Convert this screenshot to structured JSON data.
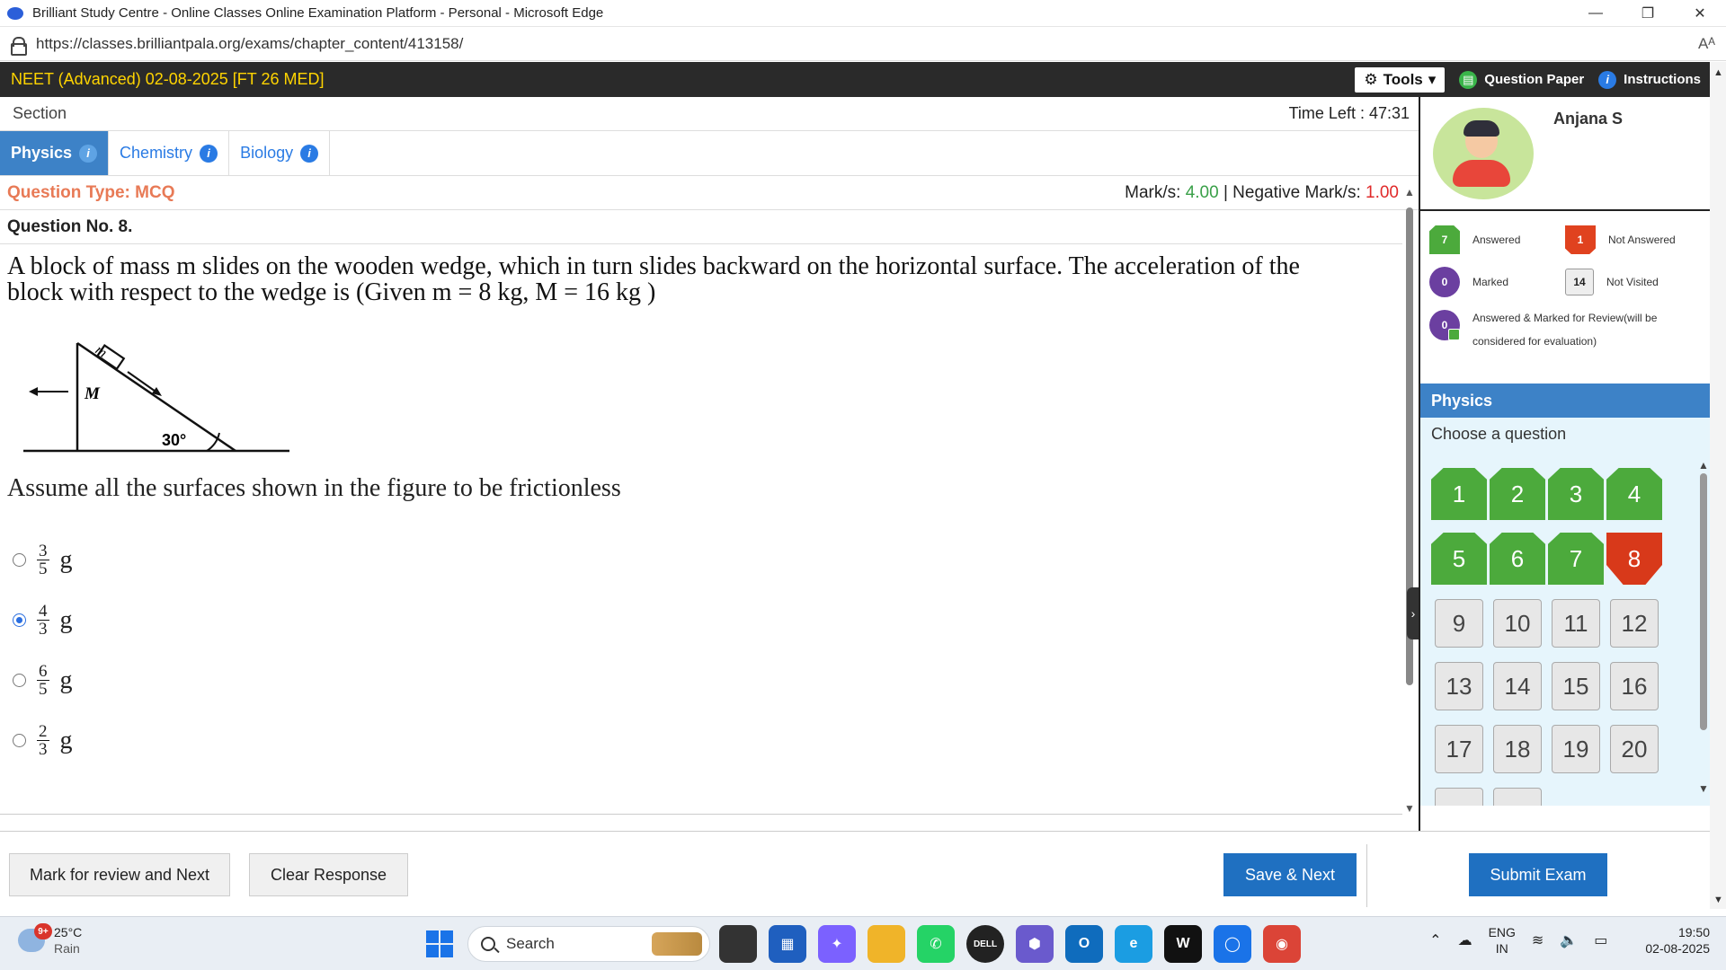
{
  "browser": {
    "window_title": "Brilliant Study Centre - Online Classes Online Examination Platform - Personal - Microsoft Edge",
    "url": "https://classes.brilliantpala.org/exams/chapter_content/413158/",
    "read_aloud_label": "Aᴬ",
    "minimize": "—",
    "restore": "❐",
    "close": "✕"
  },
  "exam": {
    "title": "NEET (Advanced) 02-08-2025 [FT 26 MED]",
    "tools_label": "Tools",
    "tools_icon": "⚙",
    "tools_caret": "▾",
    "question_paper_label": "Question Paper",
    "question_paper_icon": "▤",
    "instructions_label": "Instructions",
    "instructions_icon": "i"
  },
  "section": {
    "label": "Section",
    "time_left": "Time Left : 47:31",
    "tabs": [
      {
        "label": "Physics",
        "active": true
      },
      {
        "label": "Chemistry",
        "active": false
      },
      {
        "label": "Biology",
        "active": false
      }
    ],
    "info_icon": "i"
  },
  "question": {
    "type_label": "Question Type: MCQ",
    "marks_prefix": "Mark/s: ",
    "marks_value": "4.00",
    "neg_prefix": " | Negative Mark/s: ",
    "neg_value": "1.00",
    "number_label": "Question No. 8.",
    "text_line1": "A block of mass m slides on the wooden wedge, which in turn slides backward on the horizontal surface. The acceleration of the",
    "text_line2": "block with respect to the wedge is (Given m = 8 kg, M = 16 kg )",
    "figure": {
      "mass_label": "m",
      "wedge_label": "M",
      "angle_label": "30°"
    },
    "assume_text": "Assume all the surfaces shown in the figure to be frictionless",
    "options": [
      {
        "num": "3",
        "den": "5",
        "unit": "g",
        "selected": false
      },
      {
        "num": "4",
        "den": "3",
        "unit": "g",
        "selected": true
      },
      {
        "num": "6",
        "den": "5",
        "unit": "g",
        "selected": false
      },
      {
        "num": "2",
        "den": "3",
        "unit": "g",
        "selected": false
      }
    ]
  },
  "candidate": {
    "name": "Anjana S"
  },
  "legend": {
    "answered": {
      "count": "7",
      "label": "Answered"
    },
    "not_answered": {
      "count": "1",
      "label": "Not Answered"
    },
    "marked": {
      "count": "0",
      "label": "Marked"
    },
    "not_visited": {
      "count": "14",
      "label": "Not Visited"
    },
    "answered_marked": {
      "count": "0",
      "label": "Answered & Marked for Review(will be considered for evaluation)"
    }
  },
  "palette": {
    "section_title": "Physics",
    "choose_label": "Choose a question",
    "questions": [
      {
        "n": "1",
        "status": "ans"
      },
      {
        "n": "2",
        "status": "ans"
      },
      {
        "n": "3",
        "status": "ans"
      },
      {
        "n": "4",
        "status": "ans"
      },
      {
        "n": "5",
        "status": "ans"
      },
      {
        "n": "6",
        "status": "ans"
      },
      {
        "n": "7",
        "status": "ans"
      },
      {
        "n": "8",
        "status": "nans"
      },
      {
        "n": "9",
        "status": "nv"
      },
      {
        "n": "10",
        "status": "nv"
      },
      {
        "n": "11",
        "status": "nv"
      },
      {
        "n": "12",
        "status": "nv"
      },
      {
        "n": "13",
        "status": "nv"
      },
      {
        "n": "14",
        "status": "nv"
      },
      {
        "n": "15",
        "status": "nv"
      },
      {
        "n": "16",
        "status": "nv"
      },
      {
        "n": "17",
        "status": "nv"
      },
      {
        "n": "18",
        "status": "nv"
      },
      {
        "n": "19",
        "status": "nv"
      },
      {
        "n": "20",
        "status": "nv"
      },
      {
        "n": "",
        "status": "nv"
      },
      {
        "n": "",
        "status": "nv"
      }
    ]
  },
  "footer": {
    "mark_review_label": "Mark for review and Next",
    "clear_label": "Clear Response",
    "save_next_label": "Save & Next",
    "submit_label": "Submit Exam"
  },
  "taskbar": {
    "weather_badge": "9+",
    "temperature": "25°C",
    "weather": "Rain",
    "search_label": "Search",
    "lang1": "ENG",
    "lang2": "IN",
    "time": "19:50",
    "date": "02-08-2025",
    "apps": [
      {
        "name": "task-view-icon",
        "color": "#333333",
        "glyph": ""
      },
      {
        "name": "store-icon",
        "color": "#1f5fbf",
        "glyph": "▦"
      },
      {
        "name": "copilot-icon",
        "color": "#7b61ff",
        "glyph": "✦"
      },
      {
        "name": "file-explorer-icon",
        "color": "#f0b429",
        "glyph": ""
      },
      {
        "name": "whatsapp-icon",
        "color": "#25d366",
        "glyph": "✆"
      },
      {
        "name": "dell-icon",
        "color": "#222222",
        "glyph": "DELL"
      },
      {
        "name": "m365-icon",
        "color": "#6a5acd",
        "glyph": "⬢"
      },
      {
        "name": "outlook-icon",
        "color": "#0f6cbd",
        "glyph": "O"
      },
      {
        "name": "edge-icon",
        "color": "#1b9de2",
        "glyph": "e"
      },
      {
        "name": "webex-icon",
        "color": "#111111",
        "glyph": "W"
      },
      {
        "name": "cortana-icon",
        "color": "#1a73e8",
        "glyph": "◯"
      },
      {
        "name": "chrome-icon",
        "color": "#db4437",
        "glyph": "◉"
      }
    ]
  },
  "colors": {
    "header_bg": "#2a2a2a",
    "exam_title": "#ffd400",
    "tab_active": "#3d82c7",
    "answered": "#4caa3c",
    "not_answered": "#e0421f",
    "marked": "#6b3fa0",
    "primary_button": "#1f70c1"
  }
}
